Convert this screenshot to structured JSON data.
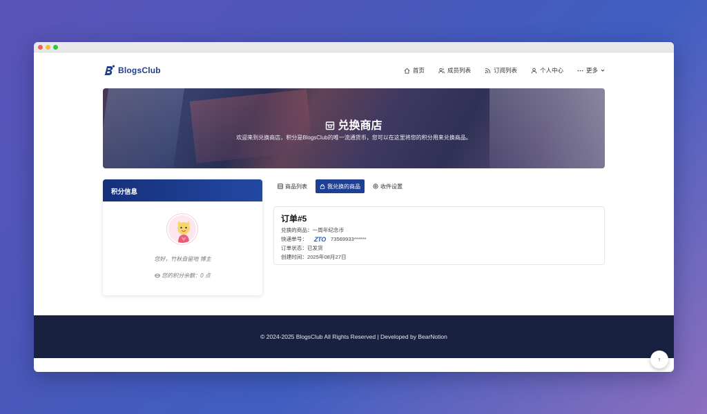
{
  "brand": {
    "name": "BlogsClub",
    "color": "#1f3d8a"
  },
  "nav": [
    {
      "label": "首页",
      "icon": "home-icon"
    },
    {
      "label": "成员列表",
      "icon": "users-icon"
    },
    {
      "label": "订阅列表",
      "icon": "rss-icon"
    },
    {
      "label": "个人中心",
      "icon": "user-icon"
    },
    {
      "label": "更多",
      "icon": "more-icon"
    }
  ],
  "banner": {
    "title": "兑换商店",
    "subtitle": "欢迎来到兑换商店，积分是BlogsClub的唯一流通货币，您可以在这里将您的积分用来兑换商品。"
  },
  "sidebar": {
    "header": "积分信息",
    "greeting": "您好，竹秋自留地 博主",
    "points": "您的积分余额：0 点"
  },
  "tabs": [
    {
      "label": "商品列表",
      "icon": "list-icon",
      "active": false
    },
    {
      "label": "我兑换的商品",
      "icon": "lock-icon",
      "active": true
    },
    {
      "label": "收件设置",
      "icon": "gear-icon",
      "active": false
    }
  ],
  "order": {
    "title": "订单#5",
    "product_label": "兑换的商品：",
    "product": "一周年纪念币",
    "tracking_label": "快递单号：",
    "courier_logo": "ZTO",
    "tracking": "73569933******",
    "status_label": "订单状态：",
    "status": "已发货",
    "created_label": "创建时间：",
    "created": "2025年08月27日"
  },
  "footer": {
    "text": "© 2024-2025 BlogsClub All Rights Reserved | Developed by BearNotion"
  },
  "scroll_top": {
    "label": "↑"
  },
  "colors": {
    "accent": "#1d3f94",
    "footer": "#18213f"
  }
}
